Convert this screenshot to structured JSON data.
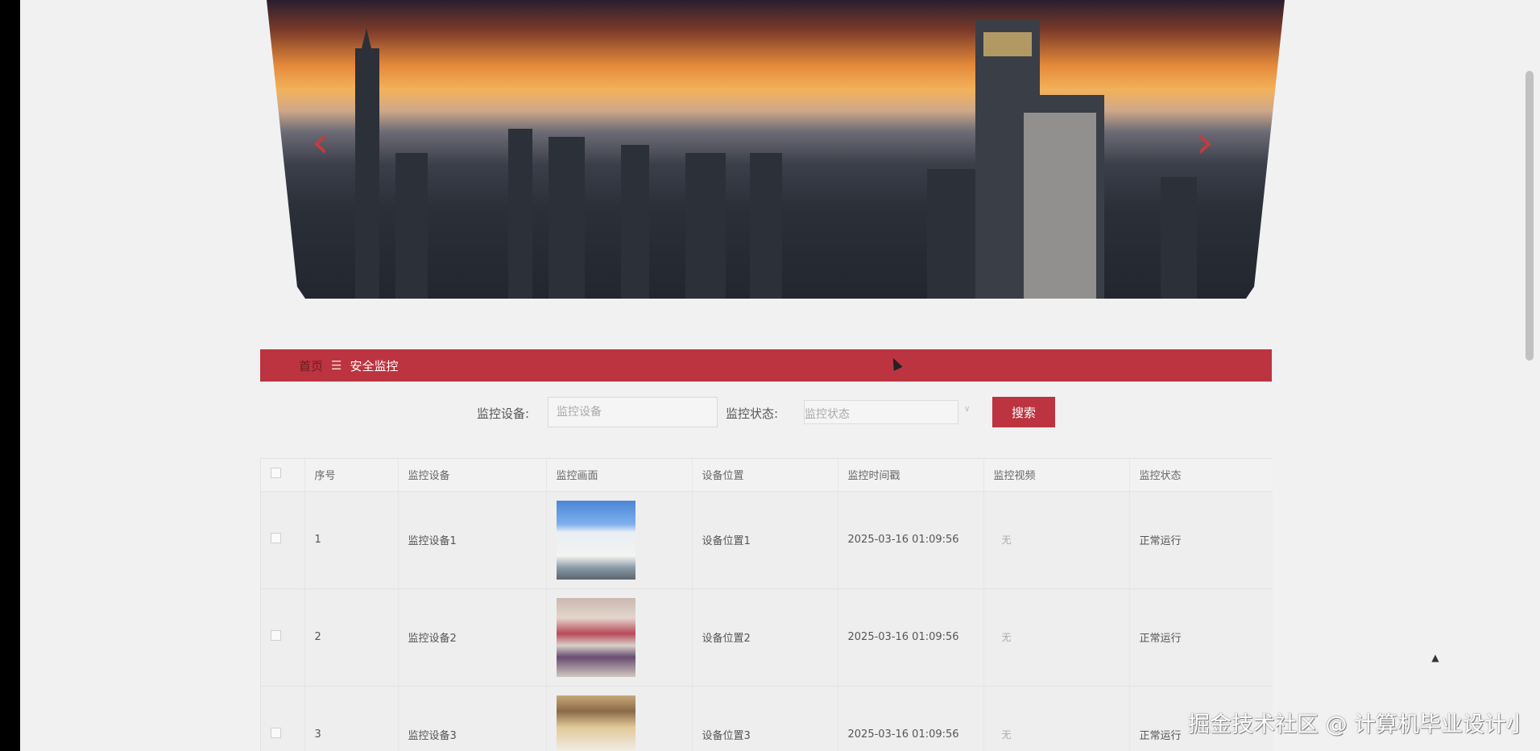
{
  "breadcrumb": {
    "home": "首页",
    "separator": "☰",
    "current": "安全监控"
  },
  "search": {
    "device_label": "监控设备:",
    "device_placeholder": "监控设备",
    "status_label": "监控状态:",
    "status_placeholder": "监控状态",
    "button": "搜索"
  },
  "table": {
    "headers": [
      "序号",
      "监控设备",
      "监控画面",
      "设备位置",
      "监控时间戳",
      "监控视频",
      "监控状态"
    ],
    "rows": [
      {
        "index": "1",
        "device": "监控设备1",
        "location": "设备位置1",
        "timestamp": "2025-03-16 01:09:56",
        "video": "无",
        "status": "正常运行"
      },
      {
        "index": "2",
        "device": "监控设备2",
        "location": "设备位置2",
        "timestamp": "2025-03-16 01:09:56",
        "video": "无",
        "status": "正常运行"
      },
      {
        "index": "3",
        "device": "监控设备3",
        "location": "设备位置3",
        "timestamp": "2025-03-16 01:09:56",
        "video": "无",
        "status": "正常运行"
      }
    ]
  },
  "carousel": {
    "prev": "‹",
    "next": "›"
  },
  "back_to_top": "▲",
  "watermark": "掘金技术社区 @ 计算机毕业设计小明哥",
  "colors": {
    "accent": "#bc3440",
    "background": "#f1f1f1"
  },
  "icons": {
    "prev": "chevron-left-icon",
    "next": "chevron-right-icon",
    "top": "arrow-up-icon"
  }
}
